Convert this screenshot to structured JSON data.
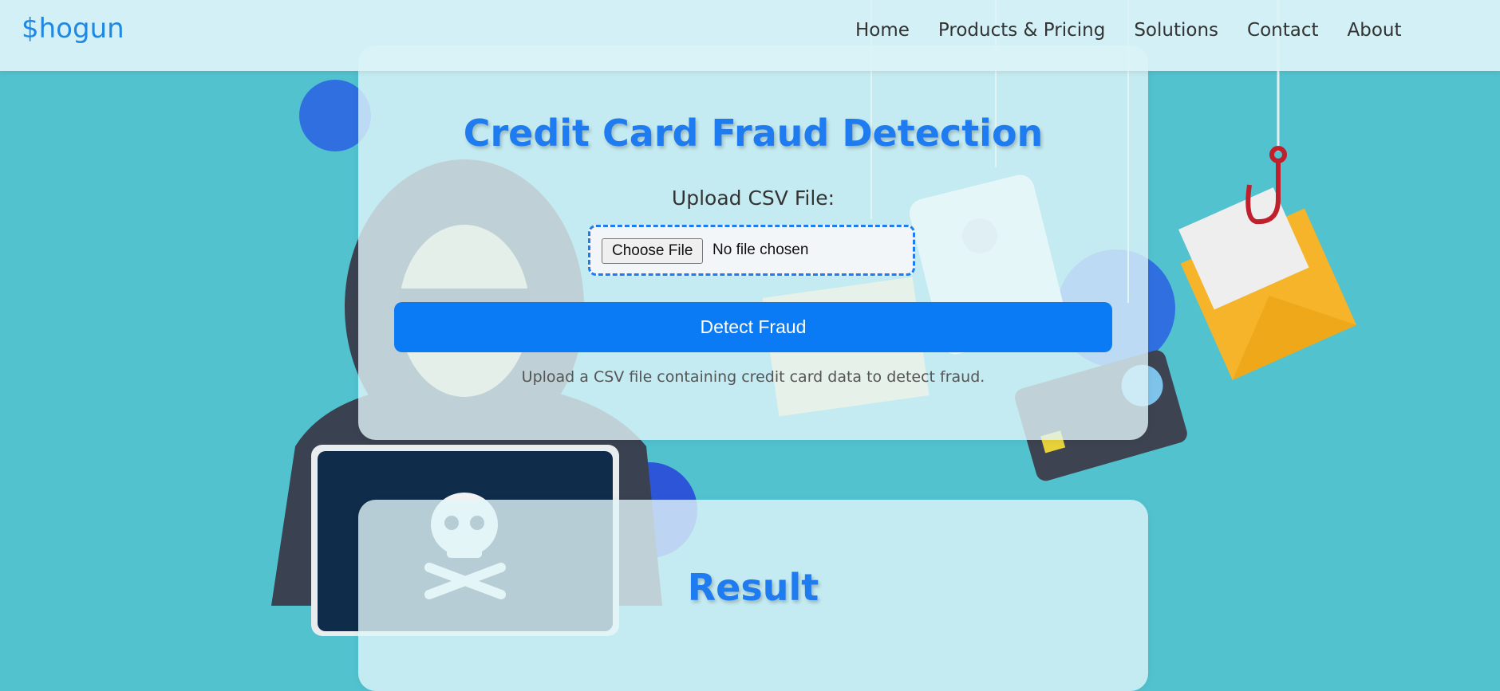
{
  "navbar": {
    "brand": "$hogun",
    "links": [
      "Home",
      "Products & Pricing",
      "Solutions",
      "Contact",
      "About"
    ]
  },
  "upload": {
    "title": "Credit Card Fraud Detection",
    "label": "Upload CSV File:",
    "choose_button": "Choose File",
    "file_status": "No file chosen",
    "detect_button": "Detect Fraud",
    "hint": "Upload a CSV file containing credit card data to detect fraud."
  },
  "result": {
    "title": "Result"
  },
  "colors": {
    "background": "#52c2cf",
    "accent": "#0a7bf5",
    "brand": "#1e88e5"
  },
  "icons": [
    "hacker-illustration",
    "skull-crossbones-icon",
    "envelope-icon",
    "fishing-hook-icon",
    "credit-card-icon",
    "id-card-icon",
    "folder-icon"
  ]
}
